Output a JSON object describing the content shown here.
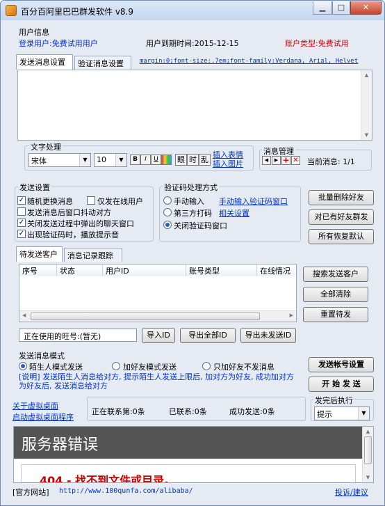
{
  "window": {
    "title": "百分百阿里巴巴群发软件 v8.9"
  },
  "user_info": {
    "group_title": "用户信息",
    "login_user": "登录用户:免费试用用户",
    "expire": "用户到期时间:2015-12-15",
    "account_type": "账户类型:免费试用"
  },
  "top_tabs": {
    "send_settings": "发送消息设置",
    "verify_settings": "验证消息设置",
    "style_text": "margin:0;font-size:.7em;font-family:Verdana, Arial, Helvet"
  },
  "text_processing": {
    "group_title": "文字处理",
    "font": "宋体",
    "size": "10",
    "bold": "B",
    "italic": "I",
    "underline": "U",
    "shake": "眼",
    "time": "时",
    "random": "乱",
    "insert_emoji": "插入表情",
    "insert_image": "插入图片"
  },
  "message_manage": {
    "group_title": "消息管理",
    "current": "当前消息: 1/1"
  },
  "send_settings": {
    "group_title": "发送设置",
    "opt1": "随机更换消息",
    "opt2": "仅发在线用户",
    "opt3": "发送消息后窗口抖动对方",
    "opt4": "关闭发送过程中弹出的聊天窗口",
    "opt5": "出现验证码时，播放提示音"
  },
  "captcha": {
    "group_title": "验证码处理方式",
    "manual": "手动输入",
    "manual_link": "手动输入验证码窗口",
    "third": "第三方打码",
    "third_link": "相关设置",
    "close": "关闭验证码窗口"
  },
  "right_buttons": {
    "batch_delete": "批量删除好友",
    "send_to_friends": "对已有好友群发",
    "restore_default": "所有恢复默认"
  },
  "customer_tabs": {
    "pending": "待发送客户",
    "log": "消息记录跟踪"
  },
  "table": {
    "columns": [
      "序号",
      "状态",
      "用户ID",
      "账号类型",
      "在线情况"
    ]
  },
  "customer_buttons": {
    "search": "搜索发送客户",
    "clear": "全部清除",
    "reset": "重置待发"
  },
  "account_bar": {
    "using": "正在使用的旺号:(暂无)",
    "import": "导入ID",
    "export_all": "导出全部ID",
    "export_unsent": "导出未发送ID"
  },
  "send_mode": {
    "group_title": "发送消息模式",
    "stranger": "陌生人模式发送",
    "add_friend": "加好友模式发送",
    "only_add": "只加好友不发消息",
    "note": "[说明] 发送陌生人消息给对方, 提示陌生人发送上限后, 加对方为好友, 成功加对方为好友后, 发送消息给对方",
    "account_settings": "发送帐号设置",
    "start": "开 始 发 送"
  },
  "status_bar": {
    "about_link": "关于虚拟桌面",
    "start_link": "启动虚拟桌面程序",
    "contacting": "正在联系第:0条",
    "contacted": "已联系:0条",
    "success": "成功发送:0条",
    "after_group": "发完后执行",
    "after_value": "提示"
  },
  "webview": {
    "title": "服务器错误",
    "subtitle": "404 - 找不到文件或目录。"
  },
  "footer": {
    "site_label": "[官方网站]",
    "url": "http://www.100qunfa.com/alibaba/",
    "feedback": "投诉/建议"
  },
  "colors": {
    "accent_blue": "#0033cc",
    "alert_red": "#d00000",
    "window_bg": "#e6ebf3"
  }
}
